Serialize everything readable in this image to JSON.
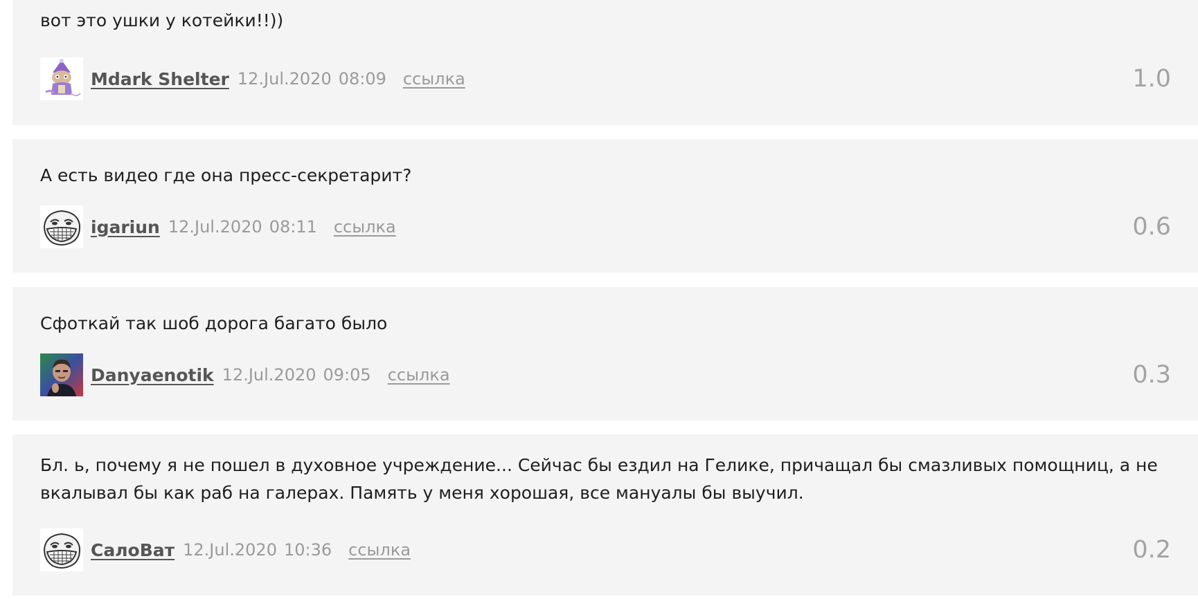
{
  "comments": [
    {
      "text": "вот это ушки у котейки!!))",
      "author": "Mdark Shelter",
      "date": "12.Jul.2020",
      "time": "08:09",
      "link_label": "ссылка",
      "rating": "1.0",
      "avatar_icon": "cartoon-cat-avatar-icon"
    },
    {
      "text": "А есть видео где она пресс-секретарит?",
      "author": "igariun",
      "date": "12.Jul.2020",
      "time": "08:11",
      "link_label": "ссылка",
      "rating": "0.6",
      "avatar_icon": "trollface-avatar-icon"
    },
    {
      "text": "Сфоткай так шоб дорога багато было",
      "author": "Danyaenotik",
      "date": "12.Jul.2020",
      "time": "09:05",
      "link_label": "ссылка",
      "rating": "0.3",
      "avatar_icon": "photo-avatar-icon"
    },
    {
      "text": "Бл. ь, почему я не пошел в духовное учреждение... Сейчас бы ездил на Гелике, причащал бы смазливых помощниц, а не вкалывал бы как раб на галерах. Память у меня хорошая, все мануалы бы выучил.",
      "author": "СалоВат",
      "date": "12.Jul.2020",
      "time": "10:36",
      "link_label": "ссылка",
      "rating": "0.2",
      "avatar_icon": "trollface-avatar-icon"
    }
  ]
}
